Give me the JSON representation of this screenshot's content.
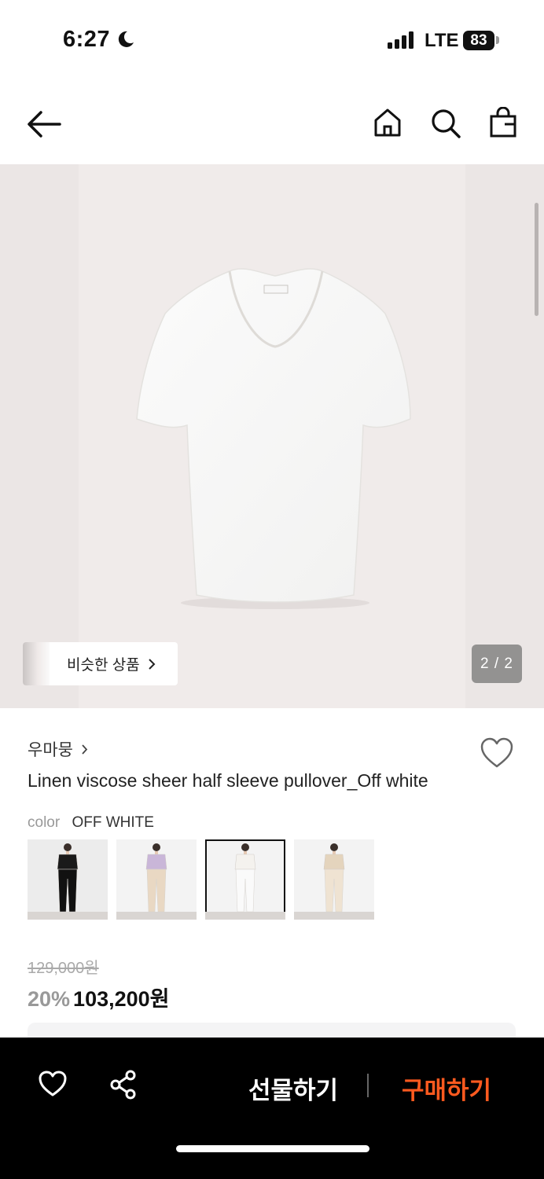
{
  "status_bar": {
    "time": "6:27",
    "network": "LTE",
    "battery": "83"
  },
  "header": {
    "back_icon": "arrow-left-icon",
    "home_icon": "home-icon",
    "search_icon": "search-icon",
    "bag_icon": "shopping-bag-icon"
  },
  "gallery": {
    "similar_label": "비슷한 상품",
    "pager": "2 / 2"
  },
  "product": {
    "brand": "우마뭉",
    "title": "Linen viscose sheer half sleeve pullover_Off white",
    "color_key": "color",
    "color_value": "OFF WHITE",
    "swatches": [
      {
        "tone": "black",
        "color": "#1a1a1a"
      },
      {
        "tone": "lavender",
        "color": "#c9b6d8"
      },
      {
        "tone": "off white",
        "color": "#f4f2ee"
      },
      {
        "tone": "beige",
        "color": "#e4d4bd"
      }
    ],
    "selected_swatch": 2,
    "original_price": "129,000원",
    "discount": "20%",
    "price": "103,200원"
  },
  "bottom_bar": {
    "gift_label": "선물하기",
    "buy_label": "구매하기",
    "accent_color": "#ff5a1f"
  }
}
